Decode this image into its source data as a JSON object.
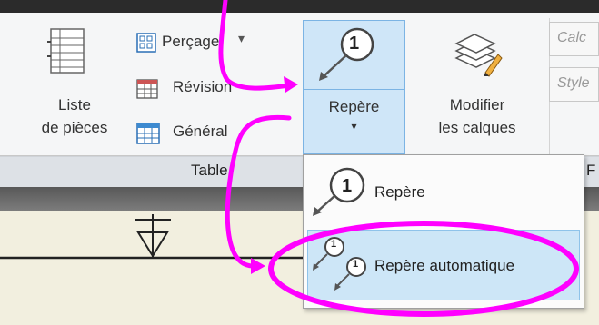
{
  "ribbon": {
    "liste_line1": "Liste",
    "liste_line2": "de pièces",
    "percage": "Perçage",
    "percage_arrow": "▾",
    "revision": "Révision",
    "general": "Général",
    "repere": "Repère",
    "repere_arrow": "▾",
    "repere_icon_num": "1",
    "modifier_line1": "Modifier",
    "modifier_line2": "les calques",
    "field_calc": "Calc",
    "field_style": "Style",
    "group_table": "Table",
    "group_f": "F"
  },
  "dropdown": {
    "item1": "Repère",
    "item2": "Repère automatique",
    "num": "1"
  },
  "colors": {
    "highlight": "#ff00ff",
    "selected_bg": "#cfe6f8"
  }
}
